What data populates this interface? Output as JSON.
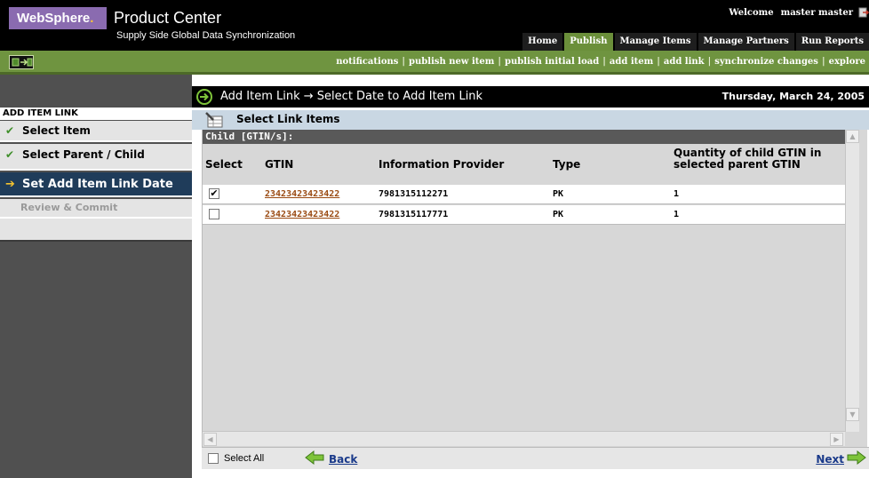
{
  "header": {
    "logo_text": "WebSphere",
    "logo_dot": ".",
    "product_name": "Product Center",
    "product_sub": "Supply Side Global Data Synchronization",
    "welcome_label": "Welcome",
    "welcome_user": "master master",
    "nav": [
      {
        "label": "Home"
      },
      {
        "label": "Publish"
      },
      {
        "label": "Manage Items"
      },
      {
        "label": "Manage Partners"
      },
      {
        "label": "Run Reports"
      }
    ],
    "active_nav": "Publish"
  },
  "subnav": {
    "links": [
      {
        "label": "notifications"
      },
      {
        "label": "publish new item"
      },
      {
        "label": "publish initial load"
      },
      {
        "label": "add item"
      },
      {
        "label": "add link"
      },
      {
        "label": "synchronize changes"
      },
      {
        "label": "explore"
      }
    ],
    "separator": "|"
  },
  "sidebar": {
    "title": "ADD ITEM LINK",
    "items": [
      {
        "label": "Select Item",
        "state": "done",
        "mark": "✔"
      },
      {
        "label": "Select Parent / Child",
        "state": "done",
        "mark": "✔"
      },
      {
        "label": "Set Add Item Link Date",
        "state": "current",
        "mark": "➔"
      },
      {
        "label": "Review & Commit",
        "state": "disabled",
        "mark": ""
      }
    ]
  },
  "main": {
    "title": "Add Item Link → Select Date to Add Item Link",
    "date": "Thursday, March 24, 2005",
    "section_title": "Select Link Items",
    "child_header": "Child [GTIN/s]:",
    "columns": [
      {
        "label": "Select"
      },
      {
        "label": "GTIN"
      },
      {
        "label": "Information Provider"
      },
      {
        "label": "Type"
      },
      {
        "label": "Quantity of child GTIN in selected parent GTIN"
      }
    ],
    "rows": [
      {
        "checked": true,
        "check_glyph": "✔",
        "gtin": "23423423423422",
        "provider": "7981315112271",
        "type": "PK",
        "quantity": "1"
      },
      {
        "checked": false,
        "check_glyph": "",
        "gtin": "23423423423422",
        "provider": "7981315117771",
        "type": "PK",
        "quantity": "1"
      }
    ],
    "select_all_label": "Select All",
    "back_label": "Back",
    "next_label": "Next"
  },
  "colors": {
    "header_bg": "#000000",
    "nav_active": "#6b8f3a",
    "subnav_bg": "#6f9440",
    "sidebar_active": "#1f3c5a",
    "link": "#1a3a8a",
    "gtin_link": "#9a4a12",
    "section_head": "#c9d7e3"
  },
  "icons": {
    "logout": "logout-icon",
    "subnav": "home-toggle-icon",
    "title_arrow": "circle-arrow-right-icon",
    "section": "pencil-table-icon",
    "back": "arrow-left-icon",
    "next": "arrow-right-icon"
  }
}
